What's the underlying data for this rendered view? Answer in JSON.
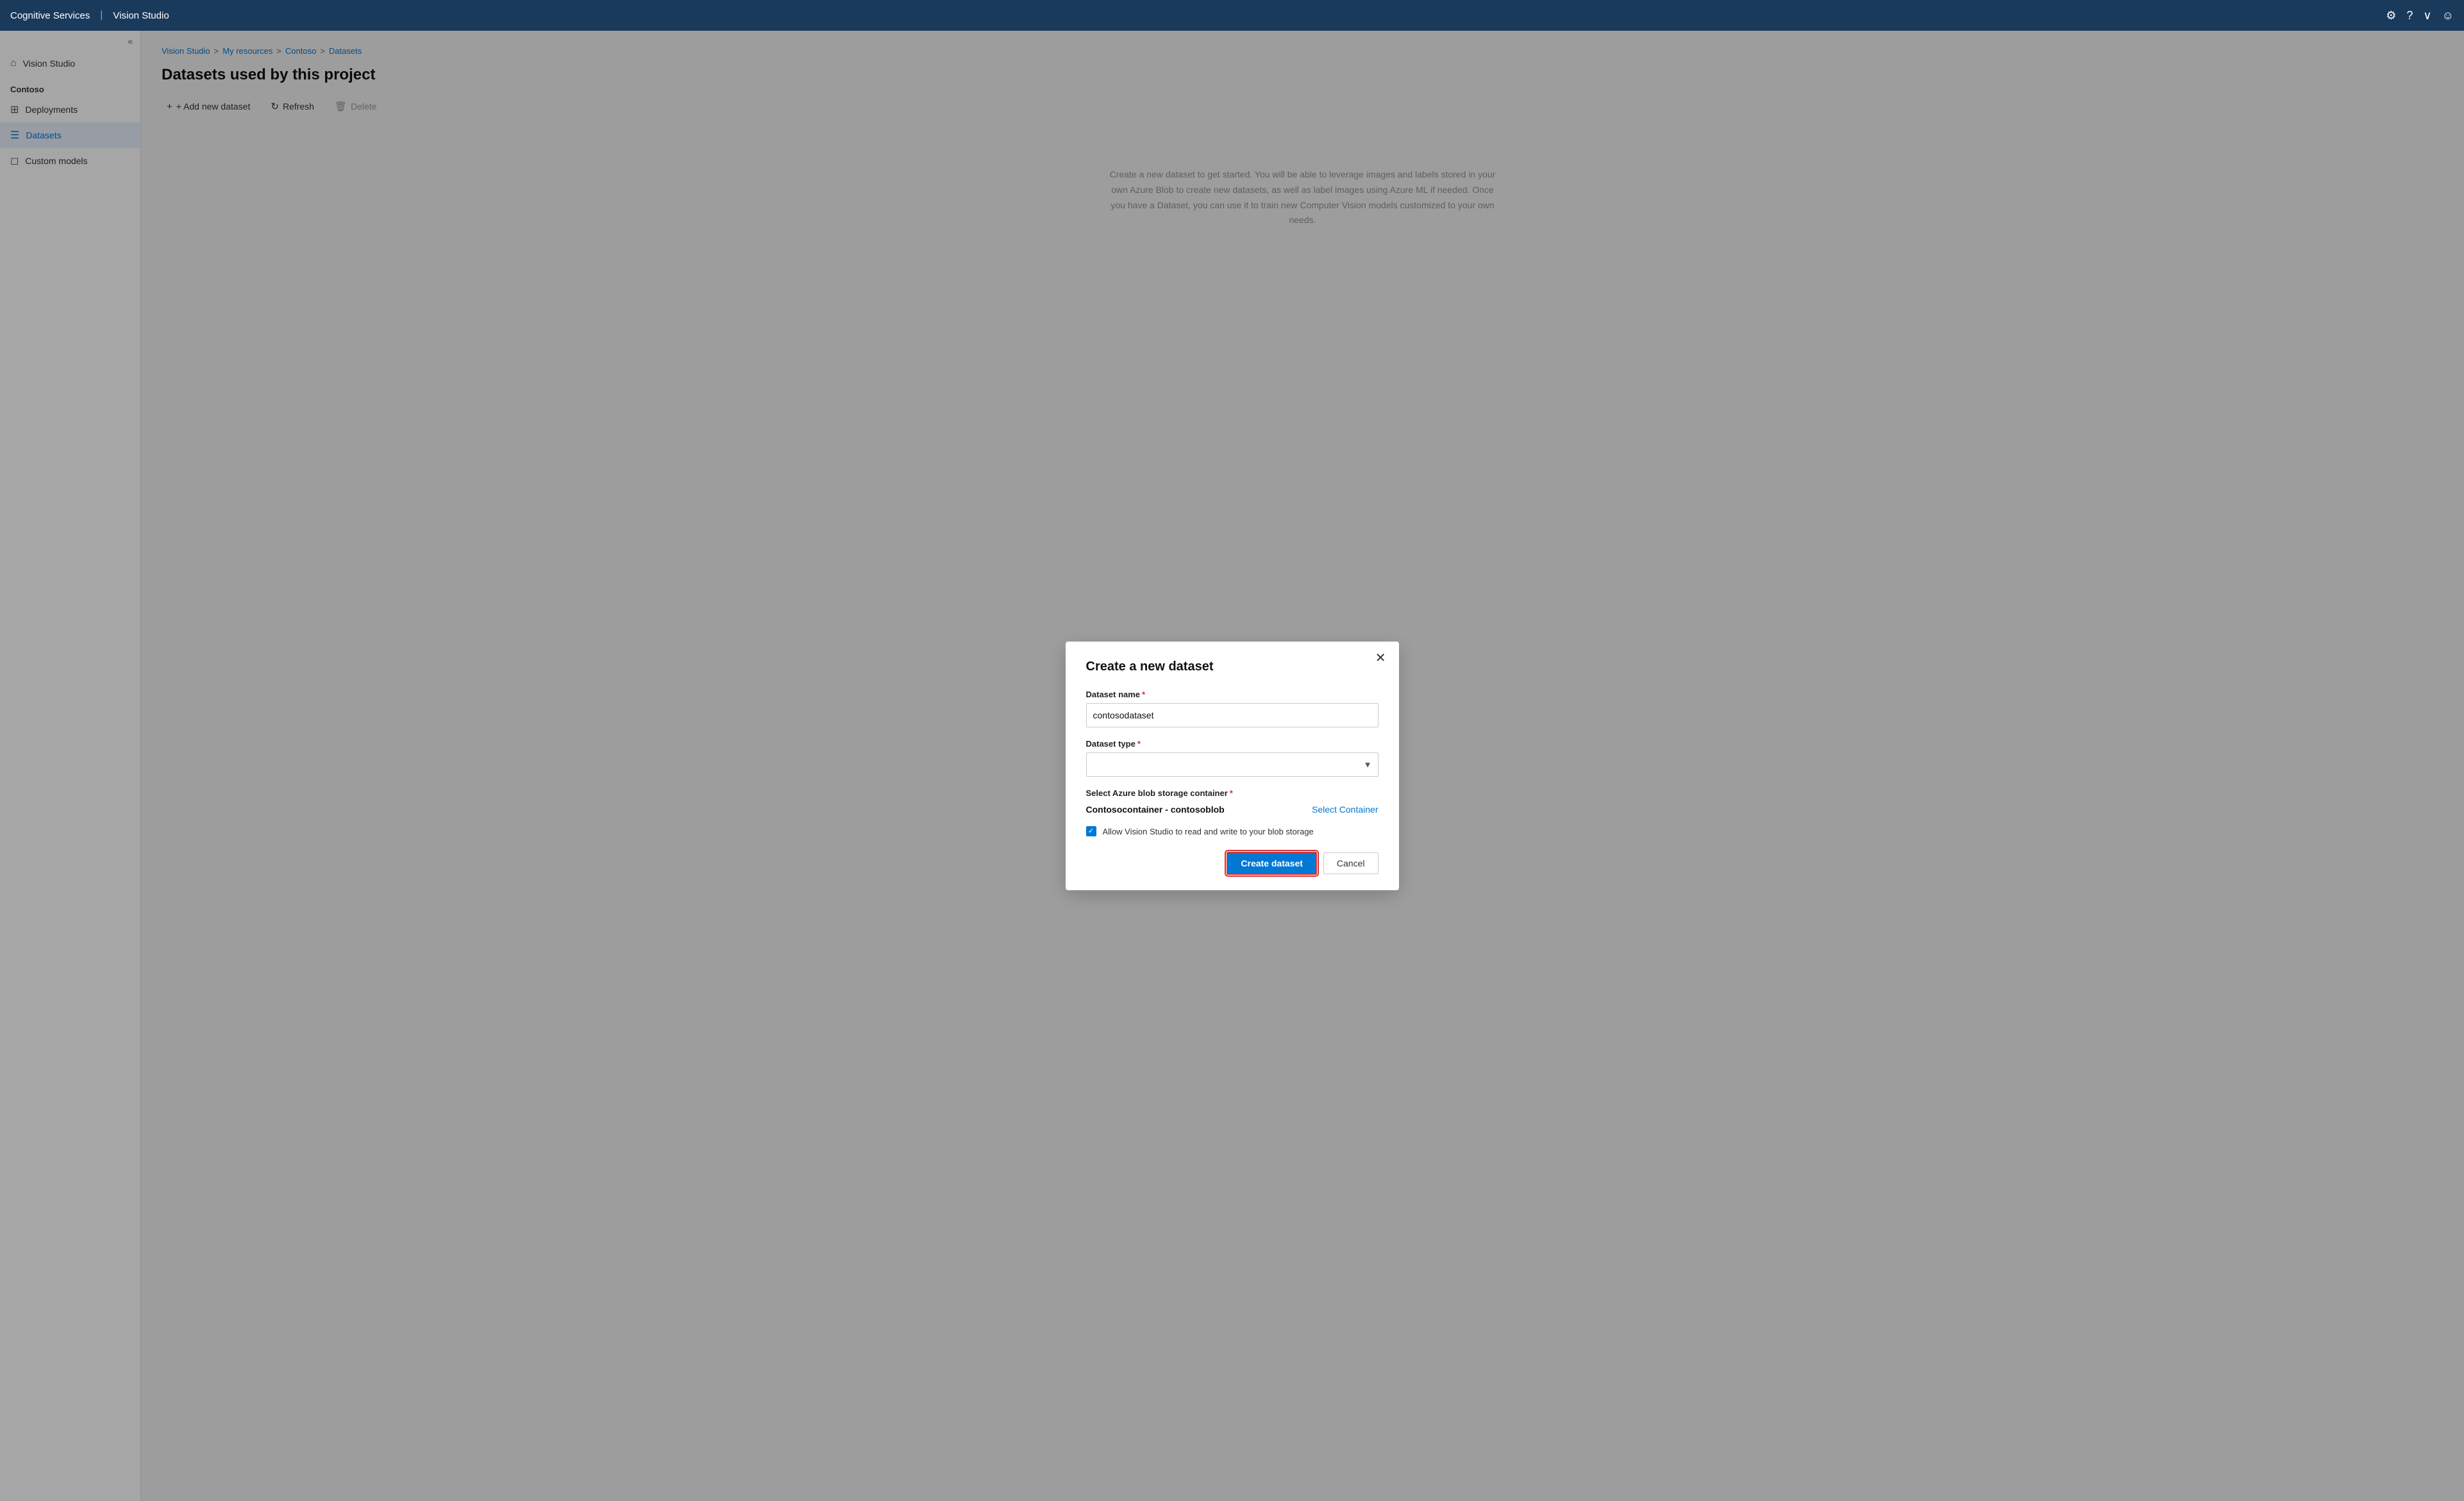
{
  "topbar": {
    "brand": "Cognitive Services",
    "divider": "|",
    "app": "Vision Studio",
    "icons": {
      "settings": "⚙",
      "help": "?",
      "dropdown": "∨",
      "user": "☺"
    }
  },
  "sidebar": {
    "collapse_icon": "«",
    "section_title": "Contoso",
    "nav_items": [
      {
        "id": "vision-studio",
        "label": "Vision Studio",
        "icon": "⌂"
      },
      {
        "id": "deployments",
        "label": "Deployments",
        "icon": "⊞"
      },
      {
        "id": "datasets",
        "label": "Datasets",
        "icon": "☰",
        "active": true
      },
      {
        "id": "custom-models",
        "label": "Custom models",
        "icon": "◻"
      }
    ]
  },
  "breadcrumb": {
    "items": [
      {
        "label": "Vision Studio",
        "link": true
      },
      {
        "label": "My resources",
        "link": true
      },
      {
        "label": "Contoso",
        "link": true
      },
      {
        "label": "Datasets",
        "link": true
      }
    ],
    "separator": ">"
  },
  "page": {
    "title": "Datasets used by this project",
    "toolbar": {
      "add": "+ Add new dataset",
      "refresh": "Refresh",
      "delete": "Delete"
    }
  },
  "dialog": {
    "title": "Create a new dataset",
    "close_icon": "✕",
    "fields": {
      "dataset_name": {
        "label": "Dataset name",
        "required": true,
        "value": "contosodataset",
        "placeholder": ""
      },
      "dataset_type": {
        "label": "Dataset type",
        "required": true,
        "value": "",
        "placeholder": ""
      },
      "storage_container": {
        "label": "Select Azure blob storage container",
        "required": true,
        "container_name": "Contosocontainer - contosoblob",
        "select_link": "Select Container"
      },
      "checkbox": {
        "checked": true,
        "label": "Allow Vision Studio to read and write to your blob storage"
      }
    },
    "actions": {
      "create": "Create dataset",
      "cancel": "Cancel"
    }
  },
  "background_text": "Create a new dataset to get started. You will be able to leverage images and labels stored in your own Azure Blob to create new datasets, as well as label images using Azure ML if needed. Once you have a Dataset, you can use it to train new Computer Vision models customized to your own needs."
}
